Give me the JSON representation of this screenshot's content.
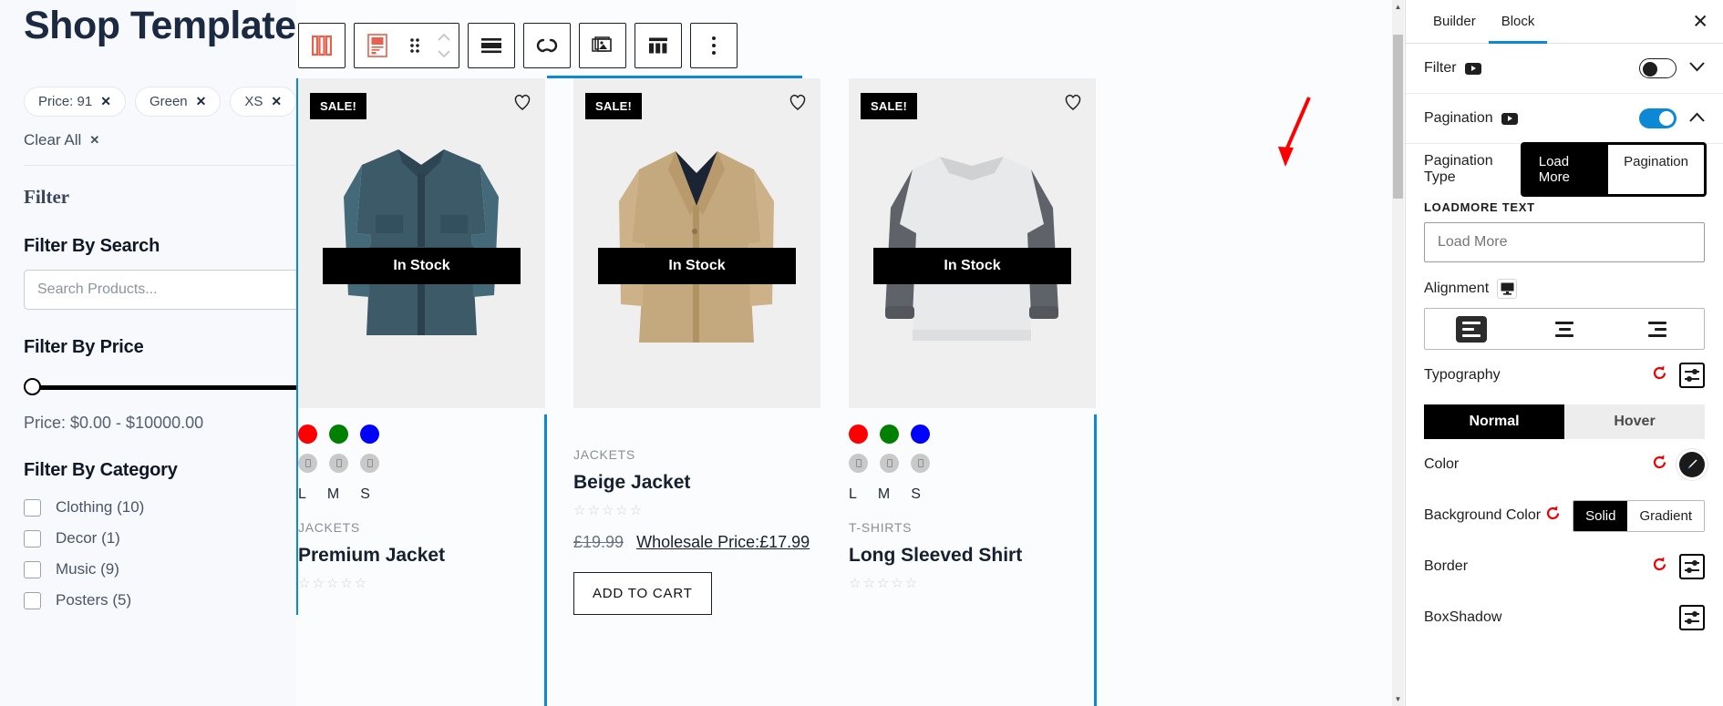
{
  "sidebar": {
    "title": "Shop Template",
    "active_filters": [
      {
        "label": "Price: 91"
      },
      {
        "label": "Green"
      },
      {
        "label": "XS"
      }
    ],
    "clear_all": "Clear All",
    "filter_heading": "Filter",
    "sections": {
      "search": {
        "title": "Filter By Search",
        "placeholder": "Search Products...",
        "value": "",
        "collapse": "−"
      },
      "price": {
        "title": "Filter By Price",
        "range_text": "Price: $0.00 - $10000.00",
        "min": "$0.00",
        "max": "$10000.00",
        "collapse": "−"
      },
      "category": {
        "title": "Filter By Category",
        "collapse": "−",
        "items": [
          {
            "label": "Clothing (10)",
            "has_children": true,
            "chevron": "›"
          },
          {
            "label": "Decor (1)",
            "has_children": false,
            "chevron": ""
          },
          {
            "label": "Music (9)",
            "has_children": true,
            "chevron": "›"
          },
          {
            "label": "Posters (5)",
            "has_children": false,
            "chevron": ""
          }
        ]
      }
    }
  },
  "toolbar": {
    "groups": [
      {
        "buttons": [
          {
            "icon": "columns-icon",
            "accent": "#e8614d"
          }
        ]
      },
      {
        "buttons": [
          {
            "icon": "product-block-icon",
            "accent": "#e8614d"
          },
          {
            "icon": "drag-handle-icon",
            "accent": "#1e1e1e"
          },
          {
            "icon": "move-updown-icon",
            "accent": "#c9c9c9"
          }
        ]
      },
      {
        "buttons": [
          {
            "icon": "align-justify-icon",
            "accent": "#1e1e1e"
          }
        ]
      },
      {
        "buttons": [
          {
            "icon": "link-infinity-icon",
            "accent": "#1e1e1e"
          }
        ]
      },
      {
        "buttons": [
          {
            "icon": "gallery-image-icon",
            "accent": "#1e1e1e"
          }
        ]
      },
      {
        "buttons": [
          {
            "icon": "table-layout-icon",
            "accent": "#1e1e1e"
          }
        ]
      },
      {
        "buttons": [
          {
            "icon": "more-options-icon",
            "accent": "#1e1e1e"
          }
        ]
      }
    ]
  },
  "products": [
    {
      "badge": "SALE!",
      "stock": "In Stock",
      "swatches": [
        "#ff0000",
        "#008000",
        "#0000ff"
      ],
      "size_circles": 3,
      "sizes": [
        "L",
        "M",
        "S"
      ],
      "category": "JACKETS",
      "name": "Premium Jacket",
      "rating": "☆☆☆☆☆",
      "price_old": "",
      "price_new": "",
      "add_to_cart": "",
      "selected": true
    },
    {
      "badge": "SALE!",
      "stock": "In Stock",
      "swatches": [],
      "size_circles": 0,
      "sizes": [],
      "category": "JACKETS",
      "name": "Beige Jacket",
      "rating": "☆☆☆☆☆",
      "price_old": "£19.99",
      "price_new": "Wholesale Price:£17.99",
      "add_to_cart": "ADD TO CART",
      "selected": false
    },
    {
      "badge": "SALE!",
      "stock": "In Stock",
      "swatches": [
        "#ff0000",
        "#008000",
        "#0000ff"
      ],
      "size_circles": 3,
      "sizes": [
        "L",
        "M",
        "S"
      ],
      "category": "T-SHIRTS",
      "name": "Long Sleeved Shirt",
      "rating": "☆☆☆☆☆",
      "price_old": "",
      "price_new": "",
      "add_to_cart": "",
      "selected": false
    }
  ],
  "right_panel": {
    "tabs": [
      {
        "label": "Builder",
        "active": false
      },
      {
        "label": "Block",
        "active": true
      }
    ],
    "close": "✕",
    "filter_section": {
      "label": "Filter",
      "enabled": false,
      "chevron": "⌄"
    },
    "pagination_section": {
      "label": "Pagination",
      "enabled": true,
      "chevron": "⌃"
    },
    "pagination_type": {
      "label": "Pagination Type",
      "options": [
        "Load More",
        "Pagination"
      ],
      "selected": "Load More"
    },
    "loadmore_text": {
      "label": "LOADMORE TEXT",
      "value": "Load More",
      "placeholder": "Load More"
    },
    "alignment": {
      "label": "Alignment",
      "device_icon": "desktop-icon",
      "options": [
        "left",
        "center",
        "right"
      ],
      "selected": "left"
    },
    "typography": {
      "label": "Typography",
      "reset_icon": "reset-icon",
      "settings_icon": "sliders-icon"
    },
    "state_toggle": {
      "options": [
        "Normal",
        "Hover"
      ],
      "selected": "Normal"
    },
    "color": {
      "label": "Color",
      "reset_icon": "reset-icon",
      "picker_icon": "brush-icon"
    },
    "background_color": {
      "label": "Background Color",
      "reset_icon": "reset-icon",
      "options": [
        "Solid",
        "Gradient"
      ],
      "selected": "Solid"
    },
    "border": {
      "label": "Border",
      "reset_icon": "reset-icon",
      "settings_icon": "sliders-icon"
    },
    "boxshadow": {
      "label": "BoxShadow",
      "settings_icon": "sliders-icon"
    }
  },
  "colors": {
    "accent_blue": "#0d88d4",
    "accent_orange": "#e8614d",
    "annotation_red": "#ff0000",
    "title_navy": "#1b2a41"
  }
}
